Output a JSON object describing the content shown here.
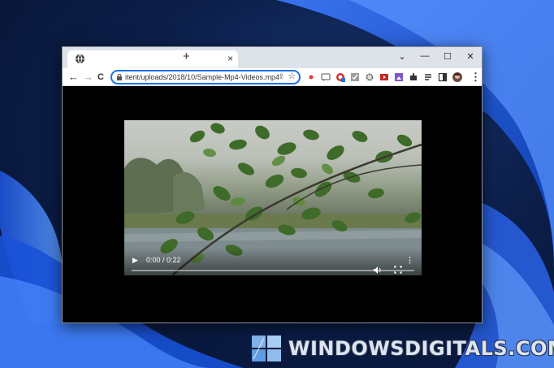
{
  "browser": {
    "tab": {
      "favicon": "globe-icon",
      "close_label": "×"
    },
    "new_tab_label": "+",
    "window_controls": {
      "dropdown": "⌄",
      "minimize": "—",
      "maximize": "☐",
      "close": "✕"
    },
    "toolbar": {
      "back": "←",
      "forward": "→",
      "reload": "C",
      "url": "itent/uploads/2018/10/Sample-Mp4-Videos.mp4",
      "share_icon": "share-icon",
      "bookmark_icon": "star-icon",
      "extensions": [
        "record-icon",
        "chat-icon",
        "opera-icon",
        "check-icon",
        "gear-icon",
        "camera-icon",
        "image-icon",
        "puzzle-icon",
        "list-icon",
        "sidebar-icon",
        "avatar",
        "menu-icon"
      ],
      "menu_label": "⋮"
    }
  },
  "video_player": {
    "play_label": "▶",
    "time": "0:00 / 0:22",
    "volume_icon": "volume-icon",
    "fullscreen_icon": "fullscreen-icon",
    "more_label": "⋮",
    "progress_fraction": 0.0
  },
  "watermark": {
    "text": "WINDOWSDIGITALS.COM"
  },
  "colors": {
    "accent": "#1a73e8",
    "desktop": "#0c1f4a",
    "titlebar": "#dee3ea"
  }
}
